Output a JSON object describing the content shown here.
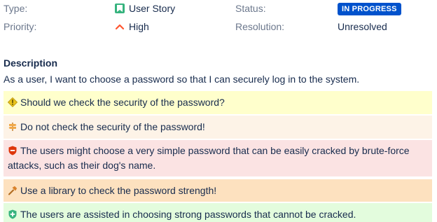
{
  "fields": {
    "type_label": "Type:",
    "type_value": "User Story",
    "status_label": "Status:",
    "status_value": "IN PROGRESS",
    "priority_label": "Priority:",
    "priority_value": "High",
    "resolution_label": "Resolution:",
    "resolution_value": "Unresolved"
  },
  "description": {
    "title": "Description",
    "text": "As a user, I want to choose a password so that I can securely log in to the system."
  },
  "panels": [
    {
      "icon": "question-icon",
      "text": "Should we check the security of the password?",
      "color": "#ffffcc"
    },
    {
      "icon": "signpost-icon",
      "text": "Do not check the security of the password!",
      "color": "#fdf3e7"
    },
    {
      "icon": "shield-minus-icon",
      "text": "The users might choose a very simple password that can be easily cracked by brute-force attacks, such as their dog's name.",
      "color": "#fbe3e3"
    },
    {
      "icon": "hammer-icon",
      "text": "Use a library to check the password strength!",
      "color": "#fde1bf"
    },
    {
      "icon": "shield-plus-icon",
      "text": "The users are assisted in choosing strong passwords that cannot be cracked.",
      "color": "#e3fcdd"
    }
  ],
  "colors": {
    "status_badge": "#0052cc",
    "story_icon": "#36b37e",
    "priority_high": "#ff5630"
  }
}
